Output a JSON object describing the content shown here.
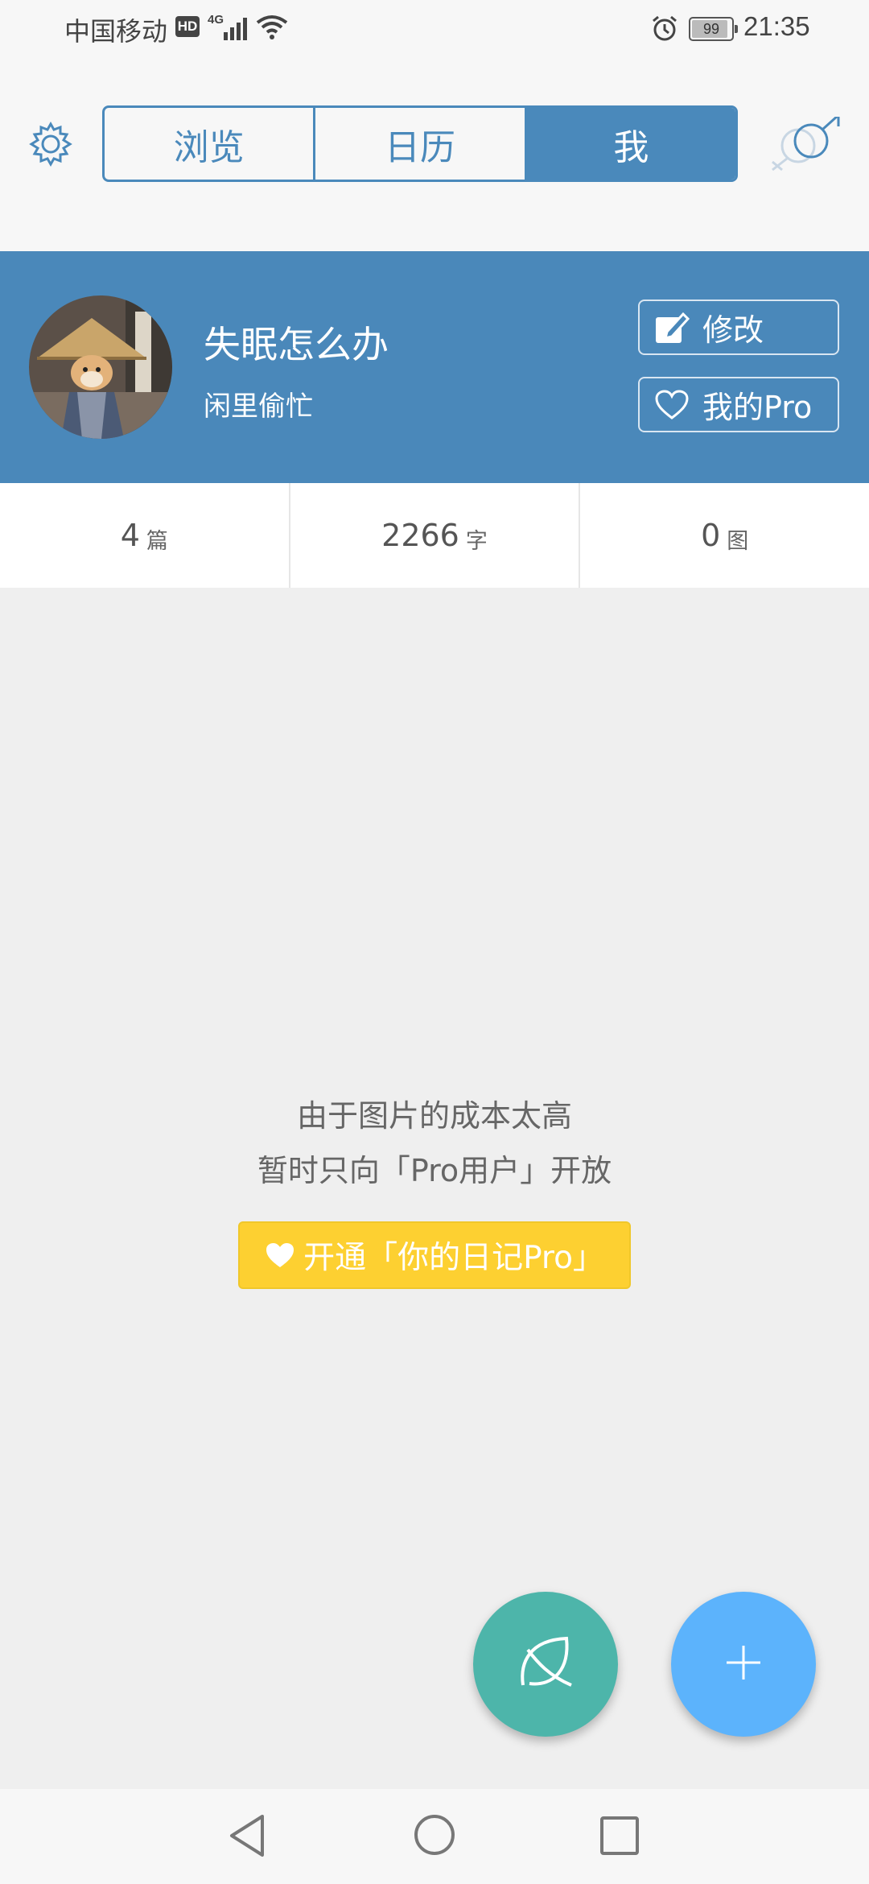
{
  "status_bar": {
    "carrier": "中国移动",
    "hd_badge": "HD",
    "network": "4G",
    "battery": "99",
    "time": "21:35",
    "icons": [
      "signal-icon",
      "wifi-icon",
      "alarm-icon",
      "battery-icon"
    ]
  },
  "header": {
    "tabs": [
      {
        "label": "浏览",
        "active": false
      },
      {
        "label": "日历",
        "active": false
      },
      {
        "label": "我",
        "active": true
      }
    ],
    "left_icon": "gear-icon",
    "right_icon": "gender-icon",
    "accent_color": "#4a89bb"
  },
  "profile": {
    "name": "失眠怎么办",
    "subtitle": "闲里偷忙",
    "edit_label": "修改",
    "pro_label": "我的Pro",
    "banner_color": "#4a88ba"
  },
  "stats": [
    {
      "value": "4",
      "unit": "篇"
    },
    {
      "value": "2266",
      "unit": "字"
    },
    {
      "value": "0",
      "unit": "图"
    }
  ],
  "notice": {
    "line1": "由于图片的成本太高",
    "line2": "暂时只向「Pro用户」开放",
    "button_label": "开通「你的日记Pro」",
    "button_color": "#fdd031"
  },
  "fabs": {
    "leaf_icon": "leaf-icon",
    "leaf_color": "#4db5aa",
    "add_icon": "plus-icon",
    "add_color": "#5cb3fc"
  },
  "nav_bar": {
    "icons": [
      "back-icon",
      "home-icon",
      "recents-icon"
    ]
  }
}
